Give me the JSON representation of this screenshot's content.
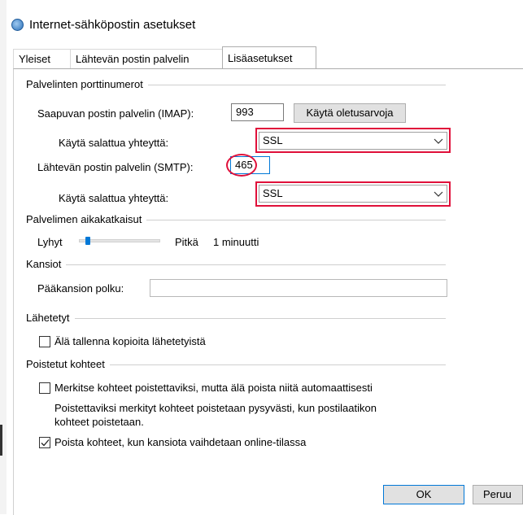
{
  "window": {
    "title": "Internet-sähköpostin asetukset"
  },
  "tabs": [
    {
      "label": "Yleiset",
      "active": false
    },
    {
      "label": "Lähtevän postin palvelin",
      "active": false
    },
    {
      "label": "Lisäasetukset",
      "active": true
    }
  ],
  "ports": {
    "group_label": "Palvelinten porttinumerot",
    "incoming_label": "Saapuvan postin palvelin (IMAP):",
    "incoming_value": "993",
    "use_defaults_label": "Käytä oletusarvoja",
    "incoming_encryption_label": "Käytä salattua yhteyttä:",
    "incoming_encryption_value": "SSL",
    "outgoing_label": "Lähtevän postin palvelin (SMTP):",
    "outgoing_value": "465",
    "outgoing_encryption_label": "Käytä salattua yhteyttä:",
    "outgoing_encryption_value": "SSL"
  },
  "timeout": {
    "group_label": "Palvelimen aikakatkaisut",
    "short_label": "Lyhyt",
    "long_label": "Pitkä",
    "value_label": "1 minuutti",
    "slider_fraction": 0.08
  },
  "folders": {
    "group_label": "Kansiot",
    "root_path_label": "Pääkansion polku:",
    "root_path_value": ""
  },
  "sent": {
    "group_label": "Lähetetyt",
    "dont_save_label": "Älä tallenna kopioita lähetetyistä",
    "dont_save_checked": false
  },
  "deleted": {
    "group_label": "Poistetut kohteet",
    "mark_label": "Merkitse kohteet poistettaviksi, mutta älä poista niitä automaattisesti",
    "mark_checked": false,
    "note_line1": "Poistettaviksi merkityt kohteet poistetaan pysyvästi, kun postilaatikon",
    "note_line2": "kohteet poistetaan.",
    "purge_label": "Poista kohteet, kun kansiota vaihdetaan online-tilassa",
    "purge_checked": true
  },
  "footer": {
    "ok_label": "OK",
    "cancel_label": "Peruu"
  },
  "colors": {
    "highlight": "#e0103a",
    "accent": "#0078d7"
  }
}
